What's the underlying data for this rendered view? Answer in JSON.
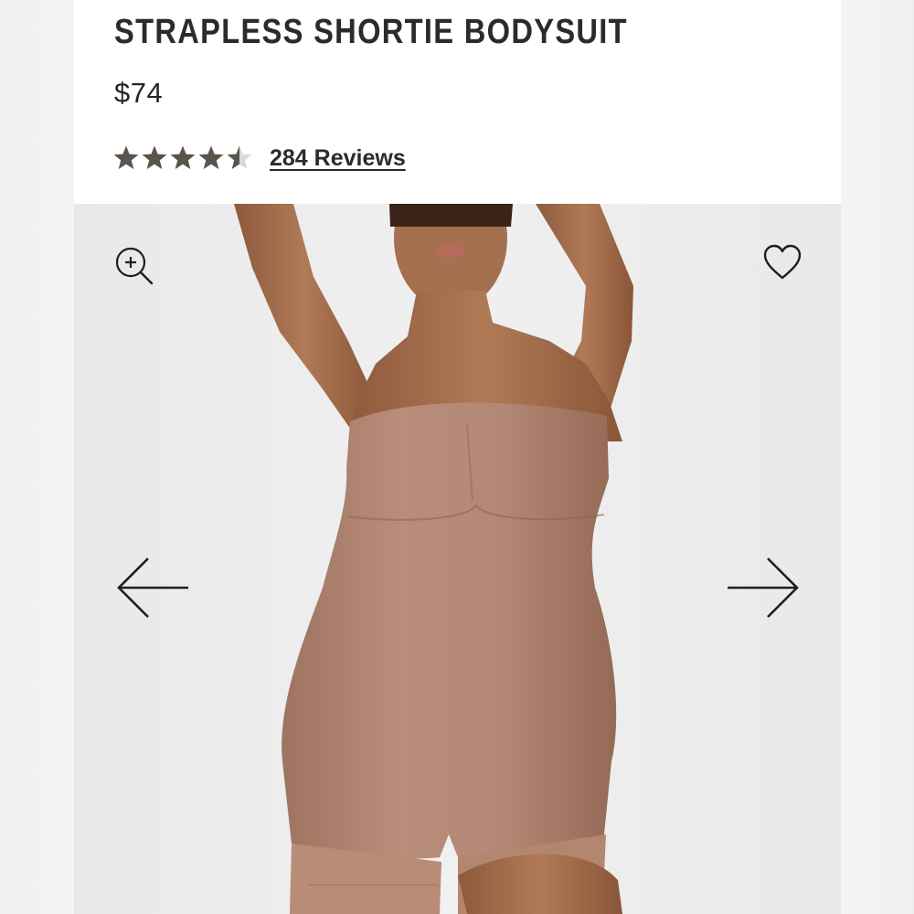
{
  "product": {
    "title": "STRAPLESS SHORTIE BODYSUIT",
    "price": "$74",
    "rating": 4.5,
    "rating_max": 5,
    "reviews_label": "284 Reviews"
  },
  "colors": {
    "text": "#2b2b2b",
    "star_filled": "#5b544c",
    "star_empty": "#d9d9d9",
    "card_bg": "#ffffff",
    "gallery_bg": "#ececec",
    "garment": "#b08572",
    "skin": "#a8714f"
  },
  "gallery": {
    "image_description_icon": "model-wearing-bodysuit-image",
    "zoom_icon": "zoom-in-icon",
    "favorite_icon": "heart-icon",
    "prev_icon": "arrow-left-icon",
    "next_icon": "arrow-right-icon"
  }
}
